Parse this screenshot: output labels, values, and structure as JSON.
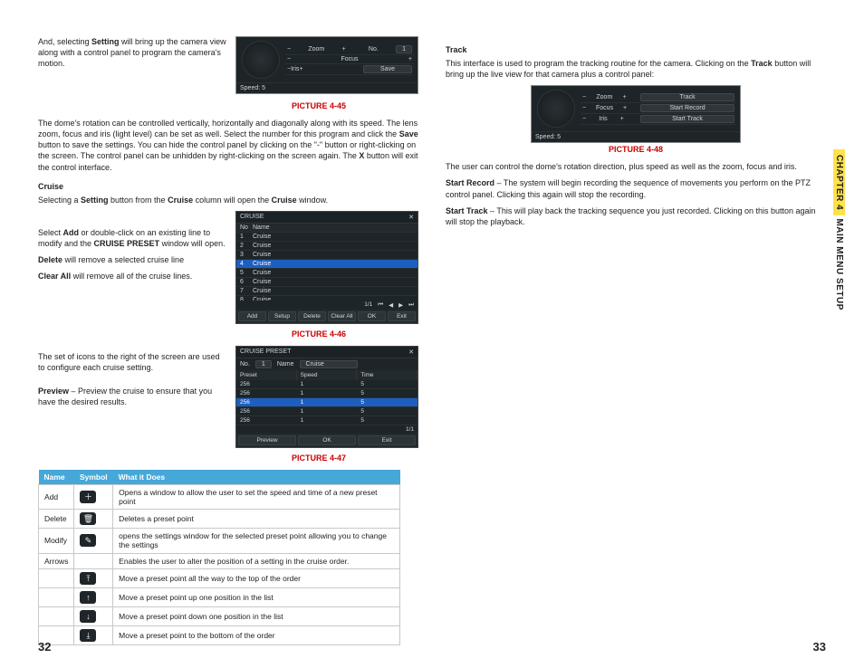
{
  "chapter_tab": {
    "chapter": "CHAPTER 4",
    "title": "MAIN MENU SETUP"
  },
  "page_left": "32",
  "page_right": "33",
  "left": {
    "intro1_a": "And, selecting ",
    "intro1_b": "Setting",
    "intro1_c": " will bring up the camera view along with a control panel to program the camera's motion.",
    "cap45": "PICTURE 4-45",
    "para_dome_a": "The dome's rotation can be controlled vertically, horizontally and diagonally along with its speed. The lens zoom, focus and iris (light level) can be set as well. Select the number for this program and click the ",
    "para_dome_b": "Save",
    "para_dome_c": " button to save the settings. You can hide the control panel by clicking on the \"-\" button or right-clicking on the screen. The control panel can be unhidden by right-clicking on the screen again. The ",
    "para_dome_d": "X",
    "para_dome_e": " button will exit the control interface.",
    "cruise_h": "Cruise",
    "cruise_p1_a": "Selecting a ",
    "cruise_p1_b": "Setting",
    "cruise_p1_c": " button from the ",
    "cruise_p1_d": "Cruise",
    "cruise_p1_e": " column will open the ",
    "cruise_p1_f": "Cruise",
    "cruise_p1_g": " window.",
    "cruise_p2_a": "Select ",
    "cruise_p2_b": "Add",
    "cruise_p2_c": " or double-click on an existing line to modify and the ",
    "cruise_p2_d": "CRUISE PRESET",
    "cruise_p2_e": " window will open.",
    "cruise_p3_a": "Delete",
    "cruise_p3_b": " will remove a selected cruise line",
    "cruise_p4_a": "Clear All",
    "cruise_p4_b": " will remove all of the cruise lines.",
    "cap46": "PICTURE 4-46",
    "icons_para": "The set of icons to the right of the screen are used to configure each cruise setting.",
    "preview_a": "Preview",
    "preview_b": " – Preview the cruise to ensure that you have the desired results.",
    "cap47": "PICTURE 4-47",
    "table_headers": [
      "Name",
      "Symbol",
      "What it Does"
    ],
    "table": [
      {
        "name": "Add",
        "sym": "＋",
        "desc": "Opens a window to allow the user to set the speed and time of a new preset point"
      },
      {
        "name": "Delete",
        "sym": "🗑",
        "desc": "Deletes a preset point"
      },
      {
        "name": "Modify",
        "sym": "✎",
        "desc": "opens the settings window for the selected preset point allowing you to change the settings"
      },
      {
        "name": "Arrows",
        "sym": "",
        "desc": "Enables the user to alter the position of a setting in the cruise order."
      },
      {
        "name": "",
        "sym": "⤒",
        "desc": "Move a preset point all the way to the top of the order"
      },
      {
        "name": "",
        "sym": "↑",
        "desc": "Move a preset point up one position in the list"
      },
      {
        "name": "",
        "sym": "↓",
        "desc": "Move a preset point down one position in the list"
      },
      {
        "name": "",
        "sym": "⤓",
        "desc": "Move a preset point to the bottom of the order"
      }
    ],
    "fig45": {
      "zoom": "Zoom",
      "focus": "Focus",
      "iris": "Iris",
      "no": "No.",
      "one": "1",
      "speed": "Speed: 5",
      "save": "Save"
    },
    "fig46": {
      "title": "CRUISE",
      "no": "No",
      "name": "Name",
      "rows": [
        [
          "1",
          "Cruise"
        ],
        [
          "2",
          "Cruise"
        ],
        [
          "3",
          "Cruise"
        ],
        [
          "4",
          "Cruise"
        ],
        [
          "5",
          "Cruise"
        ],
        [
          "6",
          "Cruise"
        ],
        [
          "7",
          "Cruise"
        ],
        [
          "8",
          "Cruise"
        ]
      ],
      "sel": 3,
      "btns": [
        "Add",
        "Setup",
        "Delete",
        "Clear All",
        "OK",
        "Exit"
      ],
      "pager": "1/1"
    },
    "fig47": {
      "title": "CRUISE PRESET",
      "fields": {
        "no": "No.",
        "one": "1",
        "name": "Name",
        "val": "Cruise"
      },
      "cols": [
        "Preset",
        "Speed",
        "Time"
      ],
      "rows": [
        [
          "256",
          "1",
          "5"
        ],
        [
          "256",
          "1",
          "5"
        ],
        [
          "256",
          "1",
          "5"
        ],
        [
          "256",
          "1",
          "5"
        ],
        [
          "256",
          "1",
          "5"
        ]
      ],
      "sel": 2,
      "pager": "1/1",
      "btns": [
        "Preview",
        "OK",
        "Exit"
      ]
    }
  },
  "right": {
    "track_h": "Track",
    "track_p1_a": "This interface is used to program the tracking routine for the camera. Clicking on the ",
    "track_p1_b": "Track",
    "track_p1_c": " button will bring up the live view for that camera plus a control panel:",
    "cap48": "PICTURE 4-48",
    "track_p2": "The user can control the dome's rotation direction, plus speed as well as the zoom, focus and iris.",
    "sr_a": "Start Record",
    "sr_b": " – The system will begin recording the sequence of movements you perform on the PTZ control panel. Clicking this again will stop the recording.",
    "st_a": "Start Track",
    "st_b": " – This will play back the tracking sequence you just recorded. Clicking on this button again will stop the playback.",
    "fig48": {
      "zoom": "Zoom",
      "focus": "Focus",
      "iris": "Iris",
      "speed": "Speed: 5",
      "track": "Track",
      "startrec": "Start Record",
      "starttrk": "Start Track"
    }
  }
}
